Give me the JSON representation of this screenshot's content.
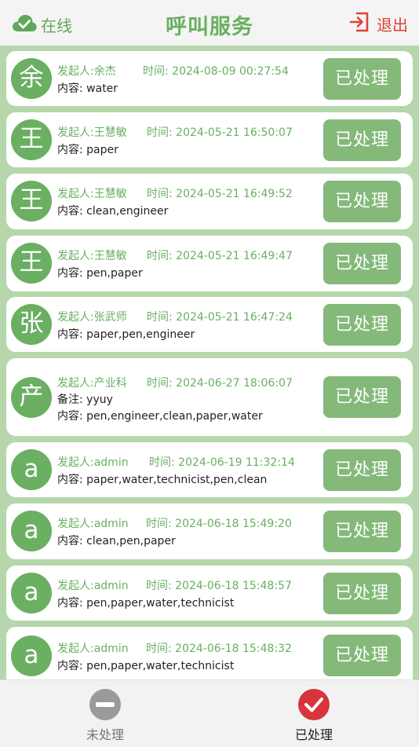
{
  "header": {
    "status_label": "在线",
    "title": "呼叫服务",
    "logout_label": "退出"
  },
  "calls": [
    {
      "avatar": "余",
      "initiator": "发起人:余杰",
      "time": "时间: 2024-08-09 00:27:54",
      "note": "",
      "content": "内容: water",
      "action": "已处理"
    },
    {
      "avatar": "王",
      "initiator": "发起人:王慧敏",
      "time": "时间: 2024-05-21 16:50:07",
      "note": "",
      "content": "内容: paper",
      "action": "已处理"
    },
    {
      "avatar": "王",
      "initiator": "发起人:王慧敏",
      "time": "时间: 2024-05-21 16:49:52",
      "note": "",
      "content": "内容: clean,engineer",
      "action": "已处理"
    },
    {
      "avatar": "王",
      "initiator": "发起人:王慧敏",
      "time": "时间: 2024-05-21 16:49:47",
      "note": "",
      "content": "内容: pen,paper",
      "action": "已处理"
    },
    {
      "avatar": "张",
      "initiator": "发起人:张武师",
      "time": "时间: 2024-05-21 16:47:24",
      "note": "",
      "content": "内容: paper,pen,engineer",
      "action": "已处理"
    },
    {
      "avatar": "产",
      "initiator": "发起人:产业科",
      "time": "时间: 2024-06-27 18:06:07",
      "note": "备注: yyuy",
      "content": "内容: pen,engineer,clean,paper,water",
      "action": "已处理"
    },
    {
      "avatar": "a",
      "initiator": "发起人:admin",
      "time": "时间: 2024-06-19 11:32:14",
      "note": "",
      "content": "内容: paper,water,technicist,pen,clean",
      "action": "已处理"
    },
    {
      "avatar": "a",
      "initiator": "发起人:admin",
      "time": "时间: 2024-06-18 15:49:20",
      "note": "",
      "content": "内容: clean,pen,paper",
      "action": "已处理"
    },
    {
      "avatar": "a",
      "initiator": "发起人:admin",
      "time": "时间: 2024-06-18 15:48:57",
      "note": "",
      "content": "内容: pen,paper,water,technicist",
      "action": "已处理"
    },
    {
      "avatar": "a",
      "initiator": "发起人:admin",
      "time": "时间: 2024-06-18 15:48:32",
      "note": "",
      "content": "内容: pen,paper,water,technicist",
      "action": "已处理"
    }
  ],
  "tabs": {
    "pending_label": "未处理",
    "done_label": "已处理"
  },
  "colors": {
    "accent": "#6aaf62",
    "button": "#84b97a",
    "list_background": "#b5d7ab",
    "logout": "#e0413a",
    "done_tab_icon": "#d9343c"
  }
}
